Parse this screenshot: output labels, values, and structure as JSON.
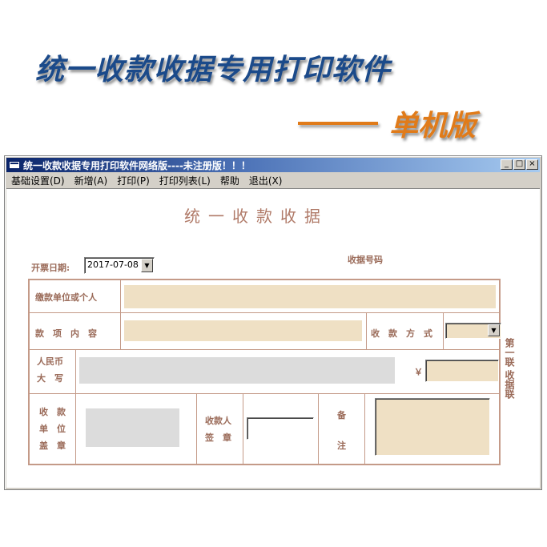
{
  "banner": {
    "title": "统一收款收据专用打印软件",
    "subtitle": "单机版",
    "title_color": "#1b4a8a",
    "subtitle_color": "#e07b1a"
  },
  "window": {
    "title": "统一收款收据专用打印软件网络版----未注册版！！！",
    "controls": [
      "minimize-icon",
      "maximize-icon",
      "close-icon"
    ]
  },
  "menu": [
    {
      "label": "基础设置(D)"
    },
    {
      "label": "新增(A)"
    },
    {
      "label": "打印(P)"
    },
    {
      "label": "打印列表(L)"
    },
    {
      "label": "帮助"
    },
    {
      "label": "退出(X)"
    }
  ],
  "receipt": {
    "title": "统一收款收据",
    "date_label": "开票日期:",
    "date_value": "2017-07-08",
    "receipt_no_label": "收据号码",
    "payer_label": "缴款单位或个人",
    "content_label": "款　项　内　容",
    "payment_method_label": "收　款　方　式",
    "rmb_label_line1": "人民币",
    "rmb_label_line2": "大　写",
    "yuan_symbol": "￥",
    "unit_stamp_label_1": "收　款",
    "unit_stamp_label_2": "单　位",
    "unit_stamp_label_3": "盖　章",
    "payee_label_1": "收款人",
    "payee_label_2": "签　章",
    "remark_label_1": "备",
    "remark_label_2": "注",
    "side_copy_label": "第一联 收据联",
    "line_color": "#c49a88",
    "field_color": "#efe0c4"
  }
}
